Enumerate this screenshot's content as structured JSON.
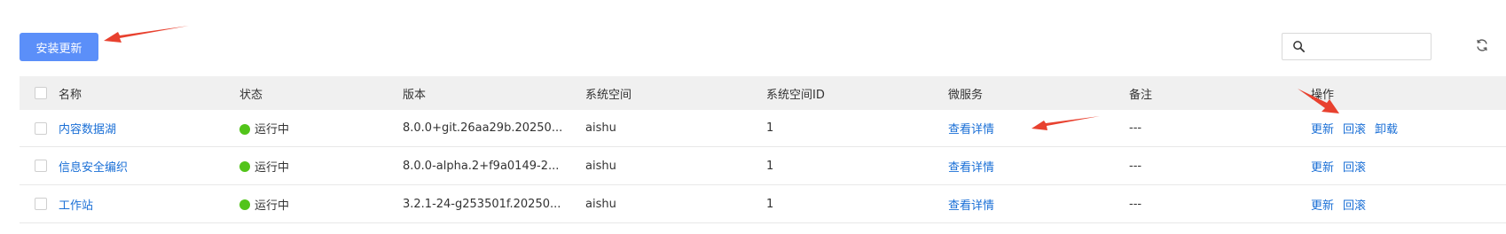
{
  "toolbar": {
    "install_label": "安装更新",
    "search_placeholder": ""
  },
  "columns": [
    "名称",
    "状态",
    "版本",
    "系统空间",
    "系统空间ID",
    "微服务",
    "备注",
    "操作"
  ],
  "rows": [
    {
      "name": "内容数据湖",
      "status": "运行中",
      "version": "8.0.0+git.26aa29b.20250...",
      "space": "aishu",
      "space_id": "1",
      "service": "查看详情",
      "note": "---",
      "actions": [
        "更新",
        "回滚",
        "卸载"
      ]
    },
    {
      "name": "信息安全编织",
      "status": "运行中",
      "version": "8.0.0-alpha.2+f9a0149-2...",
      "space": "aishu",
      "space_id": "1",
      "service": "查看详情",
      "note": "---",
      "actions": [
        "更新",
        "回滚"
      ]
    },
    {
      "name": "工作站",
      "status": "运行中",
      "version": "3.2.1-24-g253501f.20250...",
      "space": "aishu",
      "space_id": "1",
      "service": "查看详情",
      "note": "---",
      "actions": [
        "更新",
        "回滚"
      ]
    }
  ],
  "colors": {
    "primary_button": "#5b8ff9",
    "link": "#1a6fd6",
    "status_running": "#52c41a",
    "annotation_arrow": "#e8412f"
  },
  "icons": [
    "search-icon",
    "refresh-icon",
    "filter-icon"
  ]
}
